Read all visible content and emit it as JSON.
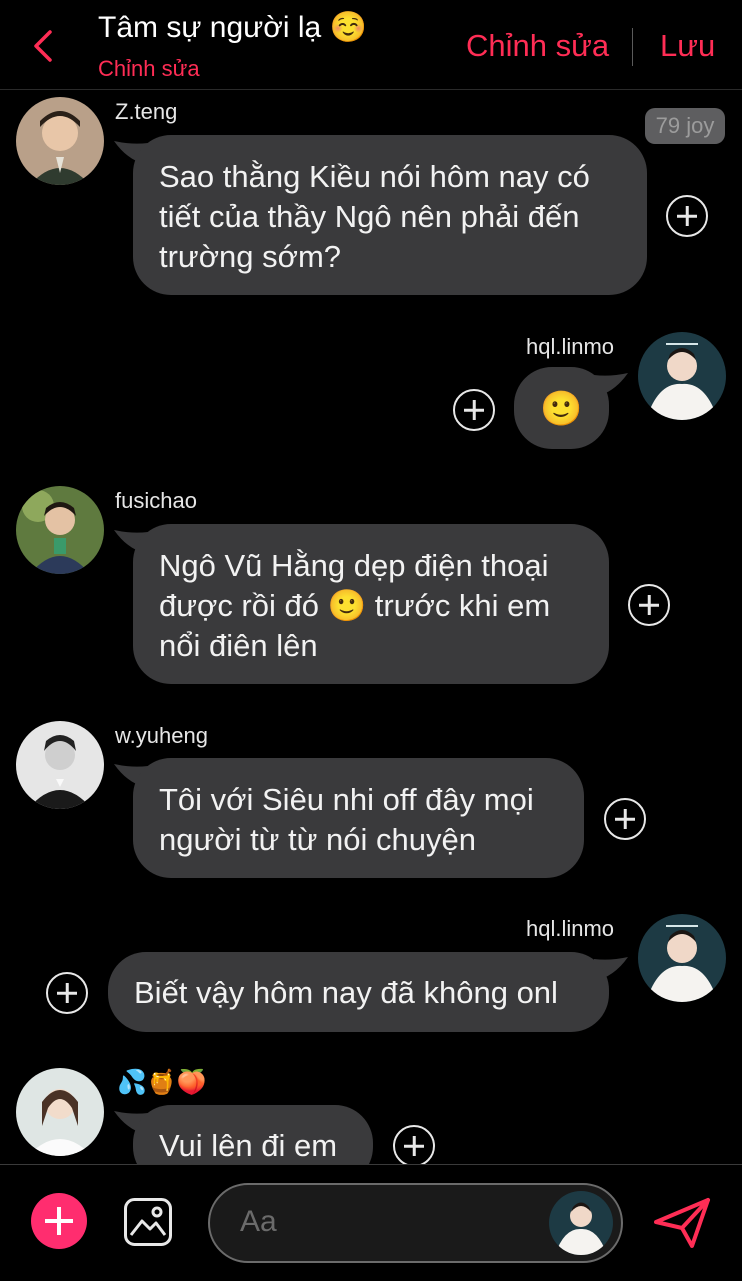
{
  "header": {
    "title": "Tâm sự người lạ ☺️",
    "subtitle": "Chỉnh sửa",
    "edit_label": "Chỉnh sửa",
    "save_label": "Lưu"
  },
  "messages": [
    {
      "user": "Z.teng",
      "text": "Sao thằng Kiều nói hôm nay có tiết của thầy Ngô nên phải đến trường sớm?",
      "side": "left",
      "badge": "79 joy"
    },
    {
      "user": "hql.linmo",
      "text": "🙂",
      "side": "right"
    },
    {
      "user": "fusichao",
      "text": "Ngô Vũ Hằng dẹp điện thoại được rồi đó 🙂 trước khi em nổi điên lên",
      "side": "left"
    },
    {
      "user": "w.yuheng",
      "text": "Tôi với Siêu nhi off đây mọi người từ từ nói chuyện",
      "side": "left"
    },
    {
      "user": "hql.linmo",
      "text": "Biết vậy hôm nay đã không onl",
      "side": "right"
    },
    {
      "user": "💦🍯🍑",
      "text": "Vui lên đi em",
      "side": "left"
    }
  ],
  "input": {
    "placeholder": "Aa"
  },
  "icons": {
    "back": "chevron-left-icon",
    "add": "plus-icon",
    "gallery": "image-icon",
    "send": "send-icon",
    "react": "plus-circle-icon"
  },
  "colors": {
    "accent": "#ff2d55",
    "add_button": "#ff2d6f",
    "bubble": "#3a3a3c",
    "background": "#000000"
  }
}
